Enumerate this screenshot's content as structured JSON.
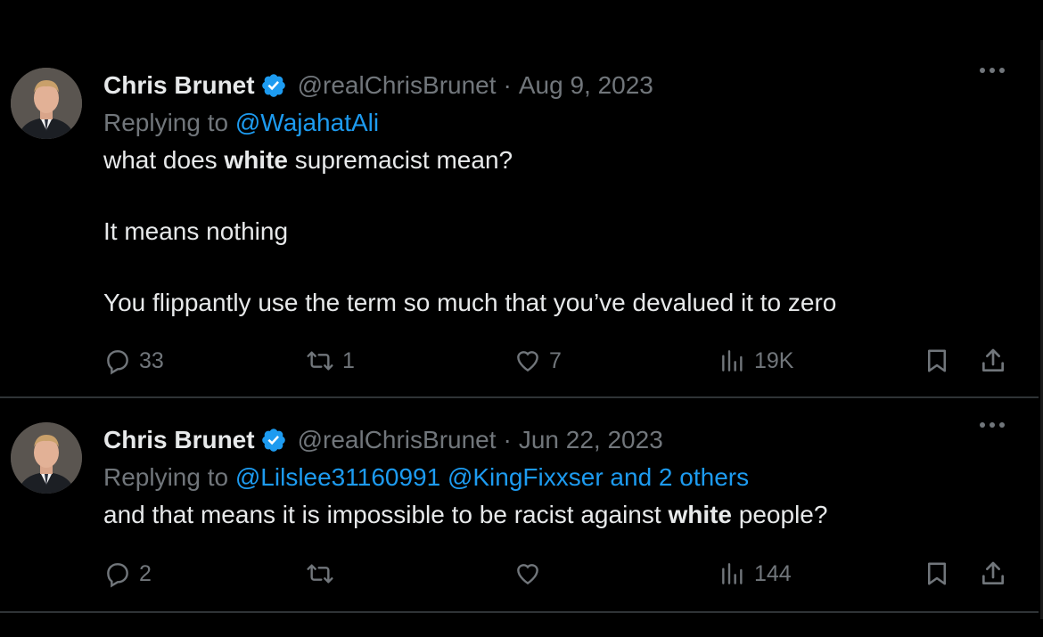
{
  "tweets": [
    {
      "author_name": "Chris Brunet",
      "handle": "@realChrisBrunet",
      "separator": "·",
      "date": "Aug 9, 2023",
      "replying_label": "Replying to",
      "replying_to": "@WajahatAli",
      "paragraphs": [
        {
          "before": "what does ",
          "bold": "white",
          "after": " supremacist mean?"
        },
        {
          "before": "It means nothing",
          "bold": "",
          "after": ""
        },
        {
          "before": "You flippantly use the term so much that you’ve devalued it to zero",
          "bold": "",
          "after": ""
        }
      ],
      "replies": "33",
      "reposts": "1",
      "likes": "7",
      "views": "19K"
    },
    {
      "author_name": "Chris Brunet",
      "handle": "@realChrisBrunet",
      "separator": "·",
      "date": "Jun 22, 2023",
      "replying_label": "Replying to",
      "replying_to": "@Lilslee31160991 @KingFixxser and 2 others",
      "paragraphs": [
        {
          "before": "and that means it is impossible to be racist against ",
          "bold": "white",
          "after": " people?"
        }
      ],
      "replies": "2",
      "reposts": "",
      "likes": "",
      "views": "144"
    }
  ],
  "colors": {
    "background": "#000000",
    "text": "#e7e9ea",
    "muted": "#71767b",
    "accent": "#1d9bf0",
    "divider": "#2f3336"
  },
  "icons": [
    "verified-badge-icon",
    "more-options-icon",
    "reply-icon",
    "repost-icon",
    "like-icon",
    "views-icon",
    "bookmark-icon",
    "share-icon"
  ]
}
